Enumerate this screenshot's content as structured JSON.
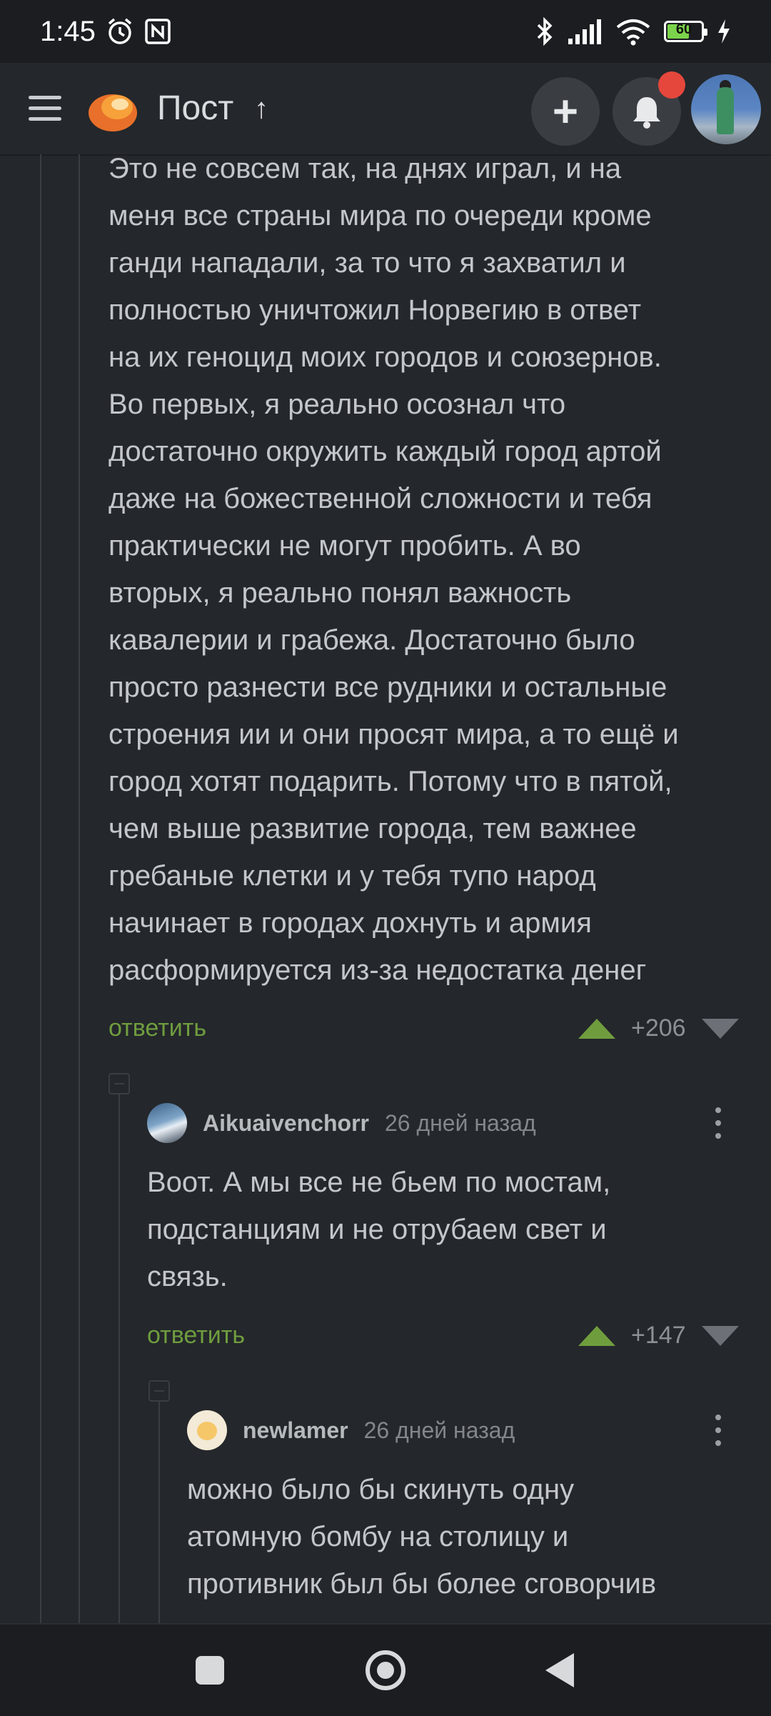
{
  "status_bar": {
    "time": "1:45",
    "battery": "60"
  },
  "app_bar": {
    "title": "Пост",
    "title_arrow": "↑",
    "add_label": "+"
  },
  "comments": [
    {
      "text": "Это не совсем так, на днях играл, и на\nменя все страны мира по очереди кроме\nганди нападали, за то что я захватил и\nполностью уничтожил Норвегию в ответ\nна их геноцид моих городов и союзернов.\nВо первых, я реально осознал что\nдостаточно окружить каждый город артой\nдаже на божественной сложности и тебя\nпрактически не могут пробить. А во\nвторых, я реально понял важность\nкавалерии и грабежа. Достаточно было\nпросто разнести все рудники и остальные\nстроения ии и они просят мира, а то ещё и\nгород хотят подарить. Потому что в пятой,\nчем выше развитие города, тем важнее\nгребаные клетки и у тебя тупо народ\nначинает в городах дохнуть и армия\nрасформируется из-за недостатка денег",
      "reply": "ответить",
      "rating": "+206"
    },
    {
      "author": "Aikuaivenchorr",
      "time": "26 дней назад",
      "text": "Воот. А мы все не бьем по мостам,\nподстанциям и не отрубаем свет и\nсвязь.",
      "reply": "ответить",
      "rating": "+147"
    },
    {
      "author": "newlamer",
      "time": "26 дней назад",
      "text": "можно было бы скинуть одну\nатомную бомбу на столицу и\nпротивник был бы более сговорчив"
    }
  ],
  "colors": {
    "background": "#24272b",
    "accent_green": "#6f9d3e",
    "badge_red": "#e5473c"
  }
}
